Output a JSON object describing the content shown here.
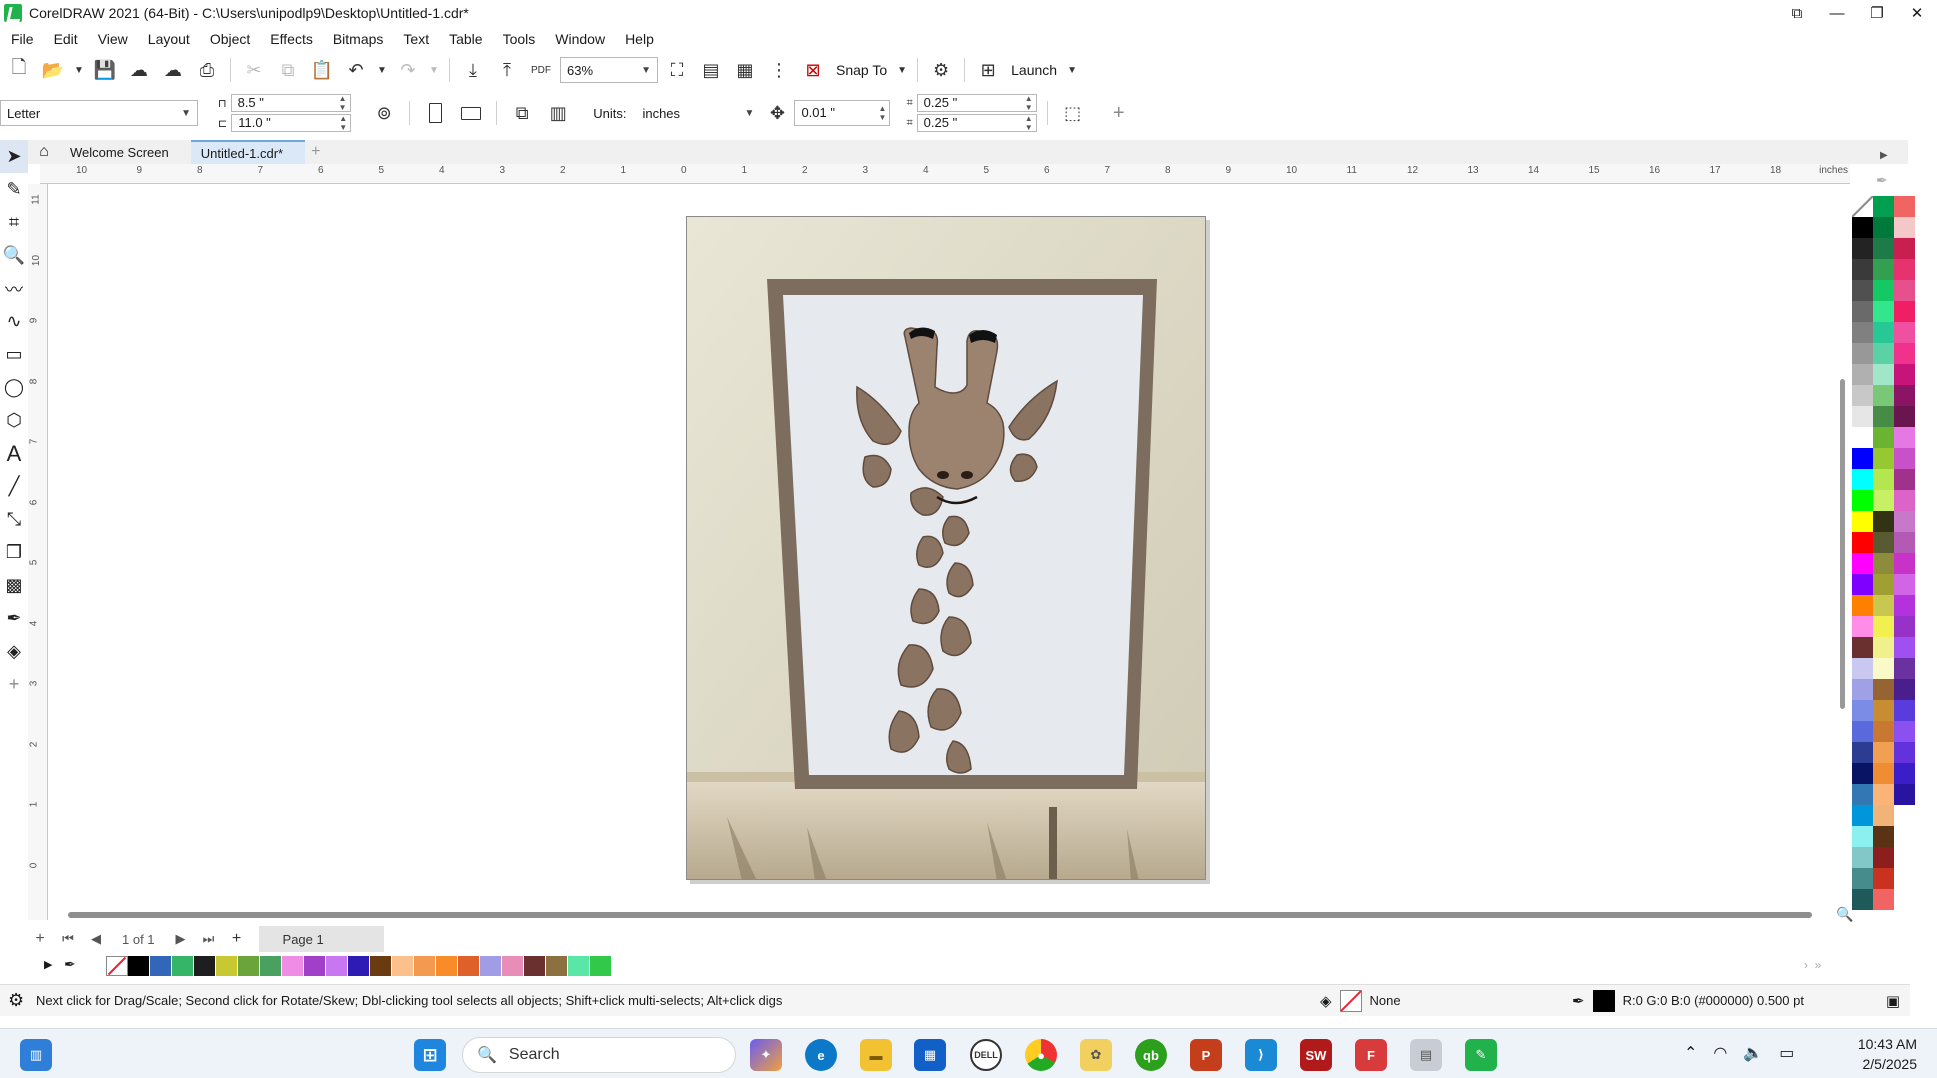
{
  "window": {
    "title": "CorelDRAW 2021 (64-Bit) - C:\\Users\\unipodlp9\\Desktop\\Untitled-1.cdr*"
  },
  "menu": [
    "File",
    "Edit",
    "View",
    "Layout",
    "Object",
    "Effects",
    "Bitmaps",
    "Text",
    "Table",
    "Tools",
    "Window",
    "Help"
  ],
  "toolbar": {
    "zoom": "63%",
    "pdf_label": "PDF",
    "snap_to": "Snap To",
    "launch": "Launch"
  },
  "property_bar": {
    "page_size": "Letter",
    "width": "8.5 \"",
    "height": "11.0 \"",
    "units_label": "Units:",
    "units": "inches",
    "nudge": "0.01 \"",
    "dup_x": "0.25 \"",
    "dup_y": "0.25 \""
  },
  "tabs": [
    {
      "label": "Welcome Screen",
      "active": false
    },
    {
      "label": "Untitled-1.cdr*",
      "active": true
    }
  ],
  "ruler": {
    "unit": "inches",
    "h_ticks": [
      "10",
      "9",
      "8",
      "7",
      "6",
      "5",
      "4",
      "3",
      "2",
      "1",
      "0",
      "1",
      "2",
      "3",
      "4",
      "5",
      "6",
      "7",
      "8",
      "9",
      "10",
      "11",
      "12",
      "13",
      "14",
      "15",
      "16",
      "17",
      "18"
    ],
    "v_ticks": [
      "11",
      "10",
      "9",
      "8",
      "7",
      "6",
      "5",
      "4",
      "3",
      "2",
      "1",
      "0"
    ]
  },
  "page_nav": {
    "count": "1 of 1",
    "page_tab": "Page 1"
  },
  "status": {
    "message": "Next click for Drag/Scale; Second click for Rotate/Skew; Dbl-clicking tool selects all objects; Shift+click multi-selects; Alt+click digs",
    "fill": "None",
    "outline": "R:0 G:0 B:0 (#000000)  0.500 pt"
  },
  "taskbar": {
    "search_placeholder": "Search",
    "time": "10:43 AM",
    "date": "2/5/2025"
  },
  "colors": {
    "doc_palette": [
      "#000000",
      "#3266b8",
      "#35b567",
      "#1e1e1e",
      "#c8c832",
      "#6ba43a",
      "#4aa060",
      "#f08ce6",
      "#a040c8",
      "#c877f0",
      "#2c1cb4",
      "#6a3a10",
      "#fcc08c",
      "#f49a50",
      "#f88c28",
      "#e0602a",
      "#a09ce6",
      "#e88cb8",
      "#6a3030",
      "#8c7040",
      "#5ae6a6",
      "#32c84a"
    ],
    "palette_col1": [
      "#000000",
      "#232323",
      "#3a3a3a",
      "#505050",
      "#6a6a6a",
      "#808080",
      "#989898",
      "#b0b0b0",
      "#c8c8c8",
      "#e6e6e6",
      "#ffffff",
      "#0000ff",
      "#00ffff",
      "#00ff00",
      "#ffff00",
      "#ff0000",
      "#ff00ff",
      "#8000ff",
      "#ff8000",
      "#ff8ce6",
      "#6a3030",
      "#c8c8f0",
      "#a0a0e6",
      "#7a8ce6",
      "#5a6adc",
      "#2c3c90",
      "#0a1464",
      "#3278b4",
      "#0096dc",
      "#8cf0f0",
      "#82c8c8",
      "#468c8c",
      "#1e5a5a"
    ],
    "palette_col2": [
      "#00a050",
      "#007a3a",
      "#1e7a46",
      "#32a050",
      "#14c864",
      "#32e68c",
      "#28c896",
      "#5ad2a6",
      "#a0e6c8",
      "#78c878",
      "#468c46",
      "#6ab432",
      "#96c832",
      "#b4e650",
      "#c8f064",
      "#323214",
      "#5a5a32",
      "#8c8c3c",
      "#a0a032",
      "#c8c850",
      "#f0f050",
      "#f0f08c",
      "#fafac8",
      "#966432",
      "#c88c32",
      "#c87832",
      "#f0a050",
      "#f08c32",
      "#fab478",
      "#f0b478",
      "#5a3214",
      "#8c1e1e",
      "#c8321e",
      "#f06464"
    ],
    "palette_col3": [
      "#f06464",
      "#f4c8c8",
      "#c81e50",
      "#e6326e",
      "#e6508c",
      "#f01e64",
      "#f050a0",
      "#f0328c",
      "#c8147a",
      "#8c1464",
      "#6a1450",
      "#e678e6",
      "#c850c8",
      "#a0328c",
      "#dc64c8",
      "#c878c8",
      "#b45ab4",
      "#c832c8",
      "#d264e6",
      "#b432dc",
      "#9632c8",
      "#a050f0",
      "#6a32a0",
      "#4a1e8c",
      "#5a3cdc",
      "#8c50f0",
      "#6432dc",
      "#3c1ec8",
      "#2814a0"
    ]
  }
}
